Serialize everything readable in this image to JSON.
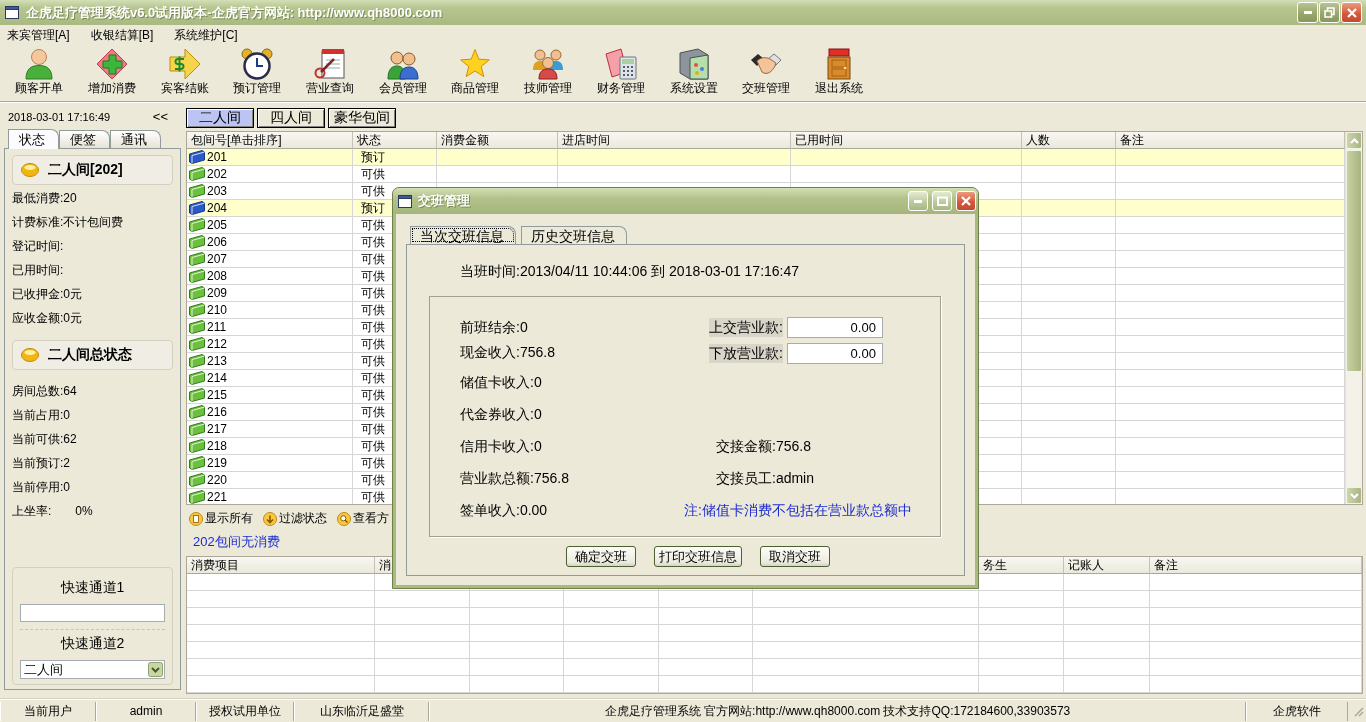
{
  "window": {
    "title": "企虎足疗管理系统v6.0试用版本-企虎官方网站: http://www.qh8000.com"
  },
  "menu": [
    {
      "label": "来宾管理[A]"
    },
    {
      "label": "收银结算[B]"
    },
    {
      "label": "系统维护[C]"
    }
  ],
  "toolbar": [
    {
      "label": "顾客开单"
    },
    {
      "label": "增加消费"
    },
    {
      "label": "宾客结账"
    },
    {
      "label": "预订管理"
    },
    {
      "label": "营业查询"
    },
    {
      "label": "会员管理"
    },
    {
      "label": "商品管理"
    },
    {
      "label": "技师管理"
    },
    {
      "label": "财务管理"
    },
    {
      "label": "系统设置"
    },
    {
      "label": "交班管理"
    },
    {
      "label": "退出系统"
    }
  ],
  "sidebar": {
    "datetime": "2018-03-01 17:16:49",
    "collapse": "<<",
    "tabs": [
      {
        "label": "状态",
        "selected": true
      },
      {
        "label": "便签",
        "selected": false
      },
      {
        "label": "通讯",
        "selected": false
      }
    ],
    "room_card": {
      "title": "二人间[202]",
      "rows": [
        {
          "text": "最低消费:20"
        },
        {
          "text": "计费标准:不计包间费"
        },
        {
          "text": "登记时间:"
        },
        {
          "text": "已用时间:"
        },
        {
          "text": "已收押金:0元"
        },
        {
          "text": "应收金额:0元"
        }
      ]
    },
    "summary_card": {
      "title": "二人间总状态",
      "rows": [
        {
          "text": "房间总数:64"
        },
        {
          "text": "当前占用:0"
        },
        {
          "text": "当前可供:62"
        },
        {
          "text": "当前预订:2"
        },
        {
          "text": "当前停用:0"
        },
        {
          "text": "上坐率:",
          "value": "0%"
        }
      ]
    },
    "quick": [
      {
        "label": "快速通道1",
        "kind": "input"
      },
      {
        "label": "快速通道2",
        "kind": "select",
        "value": "二人间"
      }
    ]
  },
  "room_tabs": [
    {
      "label": "二人间",
      "selected": true
    },
    {
      "label": "四人间",
      "selected": false
    },
    {
      "label": "豪华包间",
      "selected": false
    }
  ],
  "rooms": {
    "columns": [
      "包间号[单击排序]",
      "状态",
      "消费金额",
      "进店时间",
      "已用时间",
      "人数",
      "备注"
    ],
    "rows": [
      {
        "room": "201",
        "status": "预订",
        "reserved": true
      },
      {
        "room": "202",
        "status": "可供",
        "reserved": false
      },
      {
        "room": "203",
        "status": "可供",
        "reserved": false
      },
      {
        "room": "204",
        "status": "预订",
        "reserved": true
      },
      {
        "room": "205",
        "status": "可供",
        "reserved": false
      },
      {
        "room": "206",
        "status": "可供",
        "reserved": false
      },
      {
        "room": "207",
        "status": "可供",
        "reserved": false
      },
      {
        "room": "208",
        "status": "可供",
        "reserved": false
      },
      {
        "room": "209",
        "status": "可供",
        "reserved": false
      },
      {
        "room": "210",
        "status": "可供",
        "reserved": false
      },
      {
        "room": "211",
        "status": "可供",
        "reserved": false
      },
      {
        "room": "212",
        "status": "可供",
        "reserved": false
      },
      {
        "room": "213",
        "status": "可供",
        "reserved": false
      },
      {
        "room": "214",
        "status": "可供",
        "reserved": false
      },
      {
        "room": "215",
        "status": "可供",
        "reserved": false
      },
      {
        "room": "216",
        "status": "可供",
        "reserved": false
      },
      {
        "room": "217",
        "status": "可供",
        "reserved": false
      },
      {
        "room": "218",
        "status": "可供",
        "reserved": false
      },
      {
        "room": "219",
        "status": "可供",
        "reserved": false
      },
      {
        "room": "220",
        "status": "可供",
        "reserved": false
      },
      {
        "room": "221",
        "status": "可供",
        "reserved": false
      }
    ]
  },
  "filter_bar": [
    {
      "label": "显示所有"
    },
    {
      "label": "过滤状态"
    },
    {
      "label": "查看方"
    }
  ],
  "consumption": {
    "message": "202包间无消费",
    "columns": [
      "消费项目",
      "消",
      "务生",
      "记账人",
      "备注"
    ]
  },
  "dialog": {
    "title": "交班管理",
    "tabs": [
      {
        "label": "当次交班信息",
        "selected": true
      },
      {
        "label": "历史交班信息",
        "selected": false
      }
    ],
    "shift_time": "当班时间:2013/04/11 10:44:06 到 2018-03-01 17:16:47",
    "left": [
      "前班结余:0",
      "现金收入:756.8",
      "储值卡收入:0",
      "代金券收入:0",
      "信用卡收入:0",
      "营业款总额:756.8",
      "签单收入:0.00"
    ],
    "fields": [
      {
        "label": "上交营业款:",
        "value": "0.00"
      },
      {
        "label": "下放营业款:",
        "value": "0.00"
      }
    ],
    "right": [
      "交接金额:756.8",
      "交接员工:admin"
    ],
    "note": "注:储值卡消费不包括在营业款总额中",
    "buttons": [
      "确定交班",
      "打印交班信息",
      "取消交班"
    ]
  },
  "status_bar": [
    "当前用户",
    "admin",
    "授权试用单位",
    "山东临沂足盛堂",
    "企虎足疗管理系统 官方网站:http://www.qh8000.com 技术支持QQ:172184600,33903573",
    "企虎软件"
  ]
}
